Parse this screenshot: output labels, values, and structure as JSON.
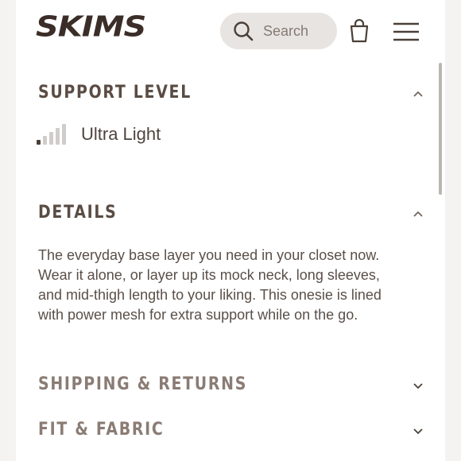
{
  "header": {
    "logo": "SKIMS",
    "search_label": "Search",
    "icons": {
      "search": "search-icon",
      "bag": "shopping-bag-icon",
      "menu": "hamburger-menu-icon"
    }
  },
  "sections": {
    "support": {
      "title": "SUPPORT LEVEL",
      "value": "Ultra Light",
      "level_filled": 1,
      "level_total": 5,
      "expanded": true
    },
    "details": {
      "title": "DETAILS",
      "text": "The everyday base layer you need in your closet now. Wear it alone, or layer up its mock neck, long sleeves, and mid-thigh length to your liking. This onesie is lined with power mesh for extra support while on the go.",
      "expanded": true
    },
    "shipping": {
      "title": "SHIPPING & RETURNS",
      "expanded": false
    },
    "fit": {
      "title": "FIT & FABRIC",
      "expanded": false
    }
  },
  "colors": {
    "text_dark": "#4a4038",
    "search_bg": "#e7e4e2",
    "side_band": "#f4f3f2"
  }
}
